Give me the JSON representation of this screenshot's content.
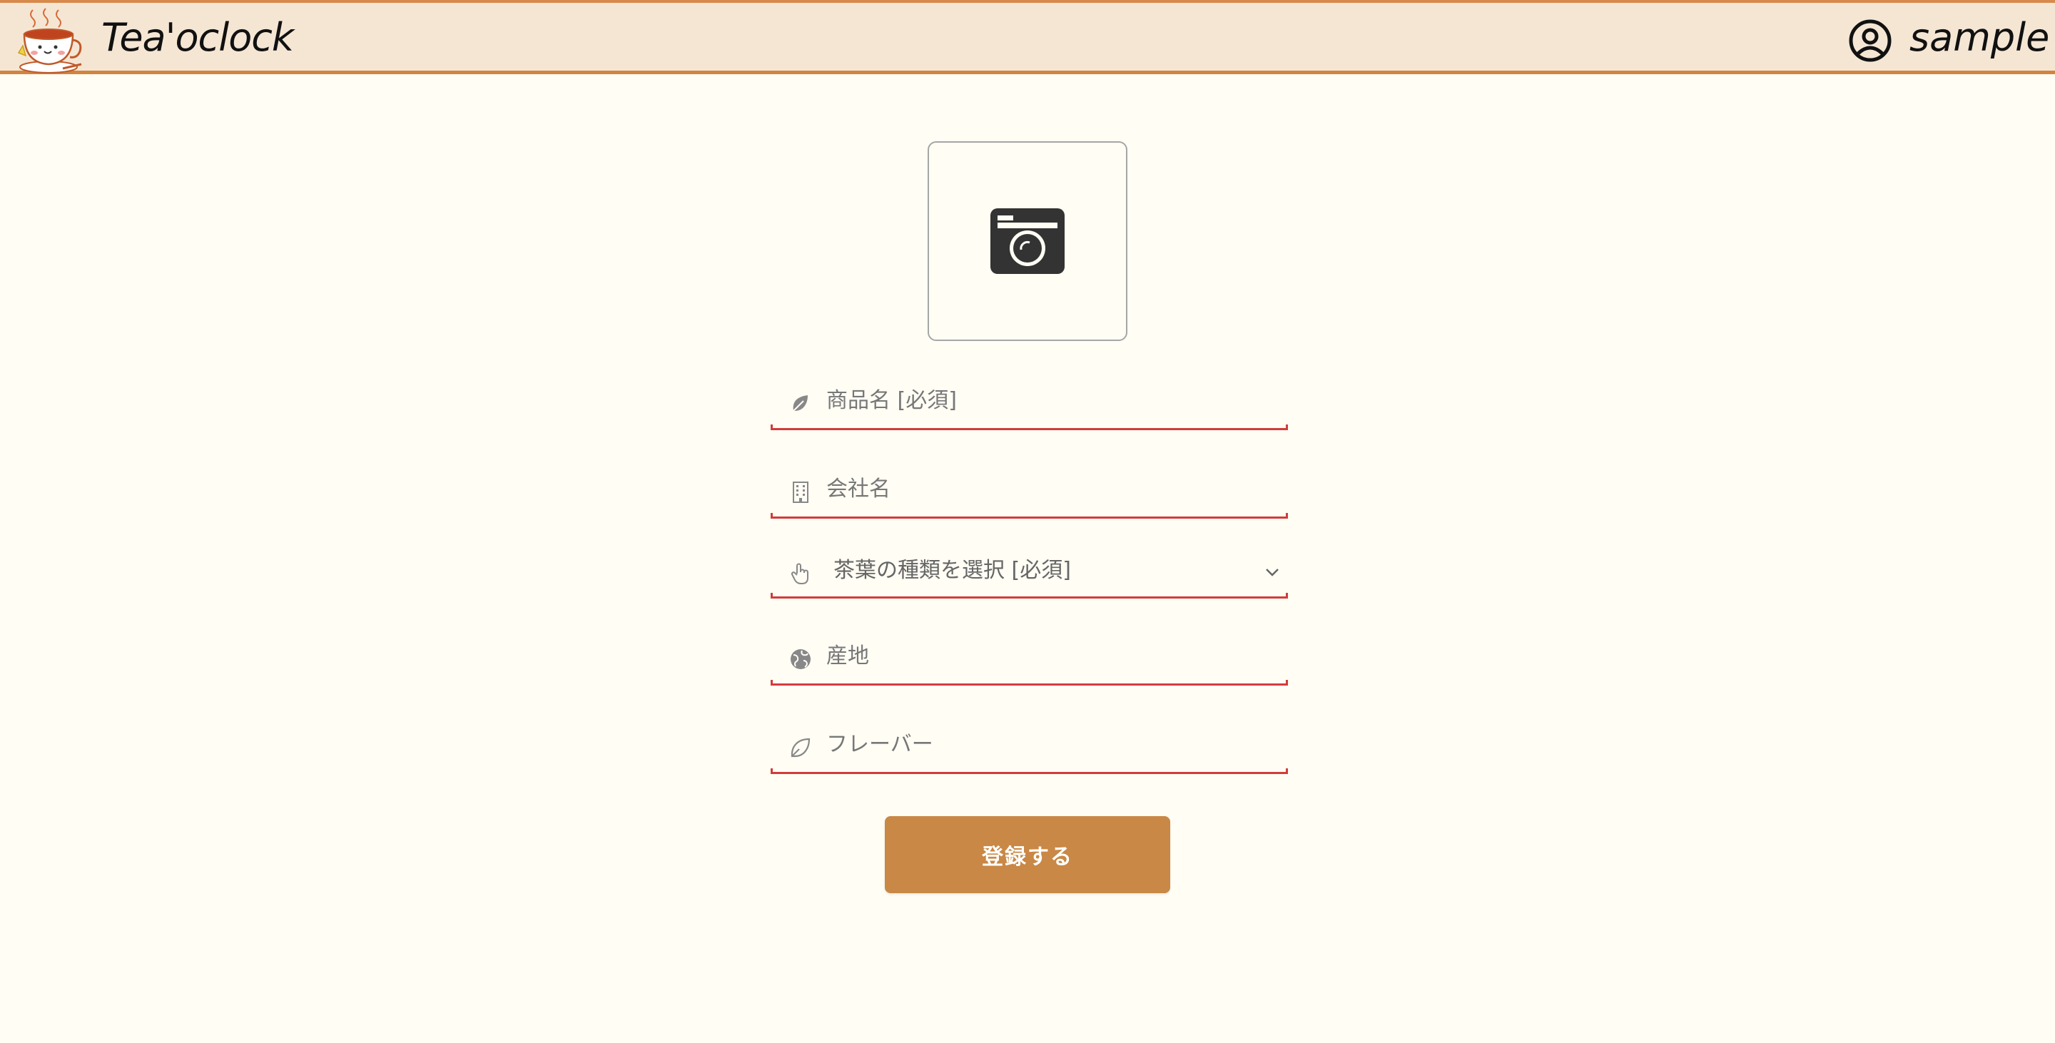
{
  "header": {
    "app_title": "Tea'oclock",
    "user_name": "sample",
    "logo_icon": "teacup-mascot-icon",
    "user_icon": "user-circle-icon"
  },
  "form": {
    "image_upload": {
      "icon": "camera-icon"
    },
    "product_name": {
      "placeholder": "商品名 [必須]",
      "icon": "leaf-icon"
    },
    "company_name": {
      "placeholder": "会社名",
      "icon": "building-icon"
    },
    "tea_type": {
      "selected": "茶葉の種類を選択 [必須]",
      "icon": "pointing-hand-icon"
    },
    "origin": {
      "placeholder": "産地",
      "icon": "globe-icon"
    },
    "flavor": {
      "placeholder": "フレーバー",
      "icon": "leaf-outline-icon"
    },
    "submit_label": "登録する"
  },
  "colors": {
    "header_bg": "#f5e6d4",
    "header_border": "#d2833f",
    "page_bg": "#fffdf4",
    "field_underline": "#d33b3b",
    "button_bg": "#c98845"
  }
}
